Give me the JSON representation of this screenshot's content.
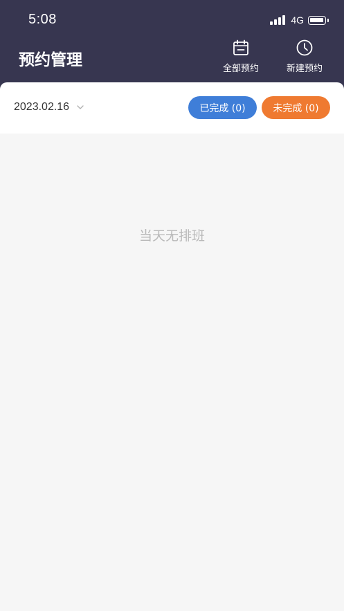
{
  "status_bar": {
    "time": "5:08",
    "network": "4G",
    "icons": [
      "signal-icon",
      "battery-icon"
    ]
  },
  "header": {
    "title": "预约管理",
    "background_color": "#373650",
    "actions": [
      {
        "label": "全部预约",
        "icon": "calendar-icon"
      },
      {
        "label": "新建预约",
        "icon": "clock-icon"
      }
    ]
  },
  "filter": {
    "date": "2023.02.16",
    "date_icon": "chevron-down-icon",
    "completed_label": "已完成 (0)",
    "completed_color": "#3f7ed8",
    "pending_label": "未完成 (0)",
    "pending_color": "#ef7a31"
  },
  "content": {
    "empty_message": "当天无排班"
  }
}
